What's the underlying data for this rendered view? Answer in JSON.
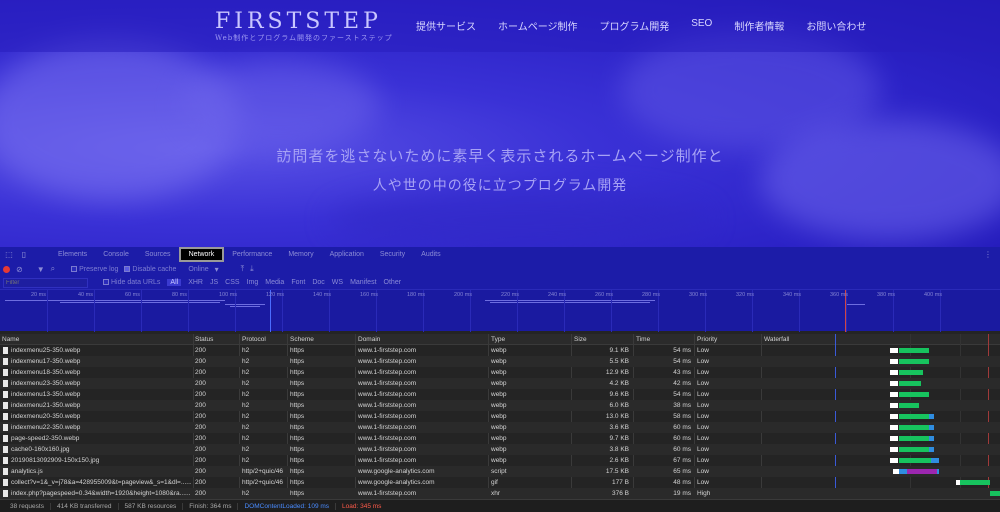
{
  "site": {
    "logo": "FIRSTSTEP",
    "logo_sub": "Web制作とプログラム開発のファーストステップ",
    "nav": [
      "提供サービス",
      "ホームページ制作",
      "プログラム開発",
      "SEO",
      "制作者情報",
      "お問い合わせ"
    ],
    "hero_line1": "訪問者を逃さないために素早く表示されるホームページ制作と",
    "hero_line2": "人や世の中の役に立つプログラム開発"
  },
  "devtools": {
    "tabs": [
      "Elements",
      "Console",
      "Sources",
      "Network",
      "Performance",
      "Memory",
      "Application",
      "Security",
      "Audits"
    ],
    "active_tab": "Network",
    "toolbar": {
      "preserve_log": "Preserve log",
      "disable_cache": "Disable cache",
      "throttle": "Online"
    },
    "filter": {
      "placeholder": "Filter",
      "hide_data_urls": "Hide data URLs",
      "types": [
        "All",
        "XHR",
        "JS",
        "CSS",
        "Img",
        "Media",
        "Font",
        "Doc",
        "WS",
        "Manifest",
        "Other"
      ]
    },
    "timeline_ticks": [
      "20 ms",
      "40 ms",
      "60 ms",
      "80 ms",
      "100 ms",
      "120 ms",
      "140 ms",
      "160 ms",
      "180 ms",
      "200 ms",
      "220 ms",
      "240 ms",
      "260 ms",
      "280 ms",
      "300 ms",
      "320 ms",
      "340 ms",
      "360 ms",
      "380 ms",
      "400 ms"
    ],
    "columns": [
      "Name",
      "Status",
      "Protocol",
      "Scheme",
      "Domain",
      "Type",
      "Size",
      "Time",
      "Priority",
      "Waterfall"
    ],
    "rows": [
      {
        "name": "indexmenu25-350.webp",
        "status": "200",
        "protocol": "h2",
        "scheme": "https",
        "domain": "www.1-firststep.com",
        "type": "webp",
        "size": "9.1 KB",
        "time": "54 ms",
        "priority": "Low"
      },
      {
        "name": "indexmenu17-350.webp",
        "status": "200",
        "protocol": "h2",
        "scheme": "https",
        "domain": "www.1-firststep.com",
        "type": "webp",
        "size": "5.5 KB",
        "time": "54 ms",
        "priority": "Low"
      },
      {
        "name": "indexmenu18-350.webp",
        "status": "200",
        "protocol": "h2",
        "scheme": "https",
        "domain": "www.1-firststep.com",
        "type": "webp",
        "size": "12.9 KB",
        "time": "43 ms",
        "priority": "Low"
      },
      {
        "name": "indexmenu23-350.webp",
        "status": "200",
        "protocol": "h2",
        "scheme": "https",
        "domain": "www.1-firststep.com",
        "type": "webp",
        "size": "4.2 KB",
        "time": "42 ms",
        "priority": "Low"
      },
      {
        "name": "indexmenu13-350.webp",
        "status": "200",
        "protocol": "h2",
        "scheme": "https",
        "domain": "www.1-firststep.com",
        "type": "webp",
        "size": "9.6 KB",
        "time": "54 ms",
        "priority": "Low"
      },
      {
        "name": "indexmenu21-350.webp",
        "status": "200",
        "protocol": "h2",
        "scheme": "https",
        "domain": "www.1-firststep.com",
        "type": "webp",
        "size": "6.0 KB",
        "time": "38 ms",
        "priority": "Low"
      },
      {
        "name": "indexmenu20-350.webp",
        "status": "200",
        "protocol": "h2",
        "scheme": "https",
        "domain": "www.1-firststep.com",
        "type": "webp",
        "size": "13.0 KB",
        "time": "58 ms",
        "priority": "Low"
      },
      {
        "name": "indexmenu22-350.webp",
        "status": "200",
        "protocol": "h2",
        "scheme": "https",
        "domain": "www.1-firststep.com",
        "type": "webp",
        "size": "3.6 KB",
        "time": "60 ms",
        "priority": "Low"
      },
      {
        "name": "page-speed2-350.webp",
        "status": "200",
        "protocol": "h2",
        "scheme": "https",
        "domain": "www.1-firststep.com",
        "type": "webp",
        "size": "9.7 KB",
        "time": "60 ms",
        "priority": "Low"
      },
      {
        "name": "cache0-160x160.jpg",
        "status": "200",
        "protocol": "h2",
        "scheme": "https",
        "domain": "www.1-firststep.com",
        "type": "webp",
        "size": "3.8 KB",
        "time": "60 ms",
        "priority": "Low"
      },
      {
        "name": "20190813092909-150x150.jpg",
        "status": "200",
        "protocol": "h2",
        "scheme": "https",
        "domain": "www.1-firststep.com",
        "type": "webp",
        "size": "2.6 KB",
        "time": "67 ms",
        "priority": "Low"
      },
      {
        "name": "analytics.js",
        "status": "200",
        "protocol": "http/2+quic/46",
        "scheme": "https",
        "domain": "www.google-analytics.com",
        "type": "script",
        "size": "17.5 KB",
        "time": "65 ms",
        "priority": "Low"
      },
      {
        "name": "collect?v=1&_v=j78&a=428955009&t=pageview&_s=1&dl=......",
        "status": "200",
        "protocol": "http/2+quic/46",
        "scheme": "https",
        "domain": "www.google-analytics.com",
        "type": "gif",
        "size": "177 B",
        "time": "48 ms",
        "priority": "Low"
      },
      {
        "name": "index.php?pagespeed=0.34&width=1920&height=1080&ra......",
        "status": "200",
        "protocol": "h2",
        "scheme": "https",
        "domain": "www.1-firststep.com",
        "type": "xhr",
        "size": "376 B",
        "time": "19 ms",
        "priority": "High"
      }
    ],
    "status": {
      "requests": "38 requests",
      "transferred": "414 KB transferred",
      "resources": "587 KB resources",
      "finish": "Finish: 364 ms",
      "dcl": "DOMContentLoaded: 109 ms",
      "load": "Load: 345 ms"
    }
  }
}
